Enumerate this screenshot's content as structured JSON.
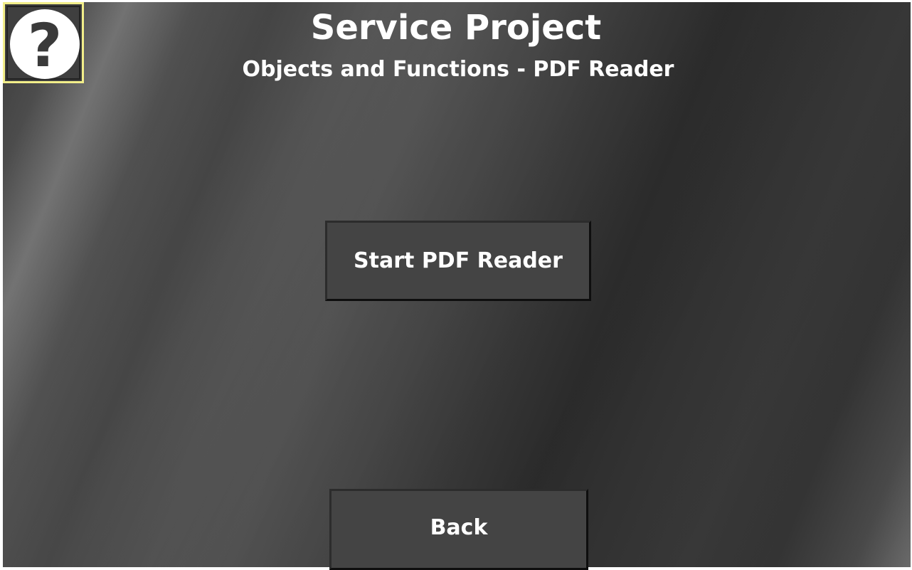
{
  "header": {
    "title": "Service Project",
    "subtitle": "Objects and Functions - PDF Reader"
  },
  "help": {
    "icon": "question-mark-icon",
    "glyph": "?"
  },
  "buttons": {
    "start_label": "Start PDF Reader",
    "back_label": "Back"
  },
  "colors": {
    "help_border": "#f2ee8a",
    "text": "#ffffff",
    "button_bg": "#444444"
  }
}
